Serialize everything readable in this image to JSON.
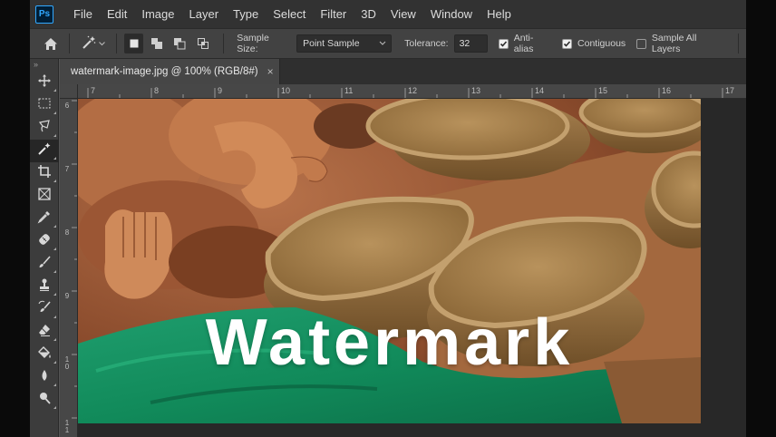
{
  "app": {
    "logo": "Ps"
  },
  "menu": [
    "File",
    "Edit",
    "Image",
    "Layer",
    "Type",
    "Select",
    "Filter",
    "3D",
    "View",
    "Window",
    "Help"
  ],
  "options": {
    "home_icon": "home-icon",
    "tool_icon": "magic-wand-icon",
    "sample_size_label": "Sample Size:",
    "sample_size_value": "Point Sample",
    "tolerance_label": "Tolerance:",
    "tolerance_value": "32",
    "anti_alias": {
      "label": "Anti-alias",
      "checked": true
    },
    "contiguous": {
      "label": "Contiguous",
      "checked": true
    },
    "sample_all_layers": {
      "label": "Sample All Layers",
      "checked": false
    }
  },
  "toolpanel": {
    "grip": "»",
    "tools": [
      "move-icon",
      "marquee-icon",
      "lasso-icon",
      "magic-wand-icon",
      "crop-icon",
      "frame-icon",
      "eyedropper-icon",
      "healing-brush-icon",
      "brush-icon",
      "clone-stamp-icon",
      "history-brush-icon",
      "eraser-icon",
      "paint-bucket-icon",
      "blur-icon",
      "dodge-icon"
    ]
  },
  "document": {
    "tab_title": "watermark-image.jpg @ 100% (RGB/8#)",
    "close": "×",
    "watermark_text": "Watermark"
  },
  "rulers": {
    "horizontal": [
      "7",
      "8",
      "9",
      "10",
      "11",
      "12",
      "13",
      "14",
      "15",
      "16",
      "17"
    ],
    "vertical": [
      "6",
      "7",
      "8",
      "9",
      "1 0",
      "1 1"
    ]
  },
  "colors": {
    "accent": "#31a8ff",
    "panel": "#535353",
    "menubar": "#323232",
    "canvas_bg": "#282828"
  }
}
